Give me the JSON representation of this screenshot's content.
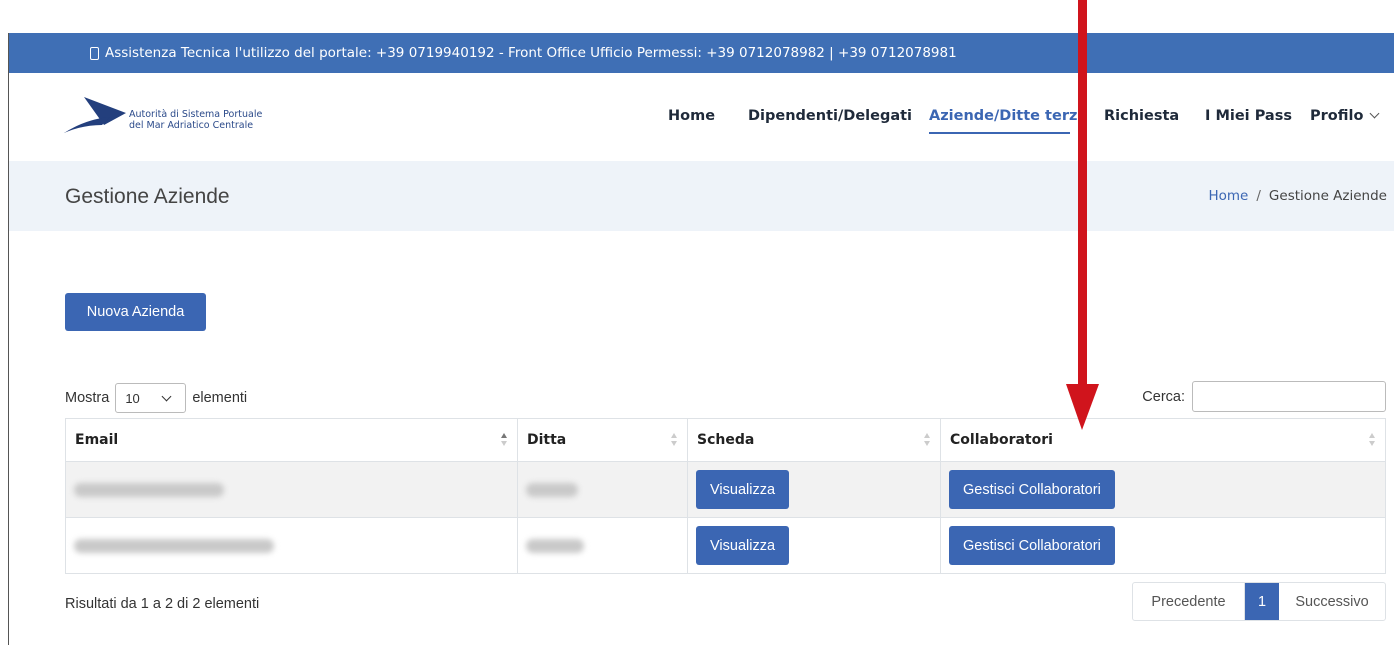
{
  "topbar": {
    "text": "Assistenza Tecnica l'utilizzo del portale: +39 0719940192 - Front Office Ufficio Permessi: +39 0712078982 | +39 0712078981"
  },
  "logo": {
    "line1": "Autorità di Sistema Portuale",
    "line2": "del Mar Adriatico Centrale"
  },
  "nav": {
    "items": [
      {
        "label": "Home"
      },
      {
        "label": "Dipendenti/Delegati"
      },
      {
        "label": "Aziende/Ditte terze",
        "active": true
      },
      {
        "label": "Richiesta"
      },
      {
        "label": "I Miei Pass"
      },
      {
        "label": "Profilo"
      }
    ]
  },
  "page": {
    "title": "Gestione Aziende",
    "breadcrumb_home": "Home",
    "breadcrumb_sep": "/",
    "breadcrumb_current": "Gestione Aziende"
  },
  "actions": {
    "new_company": "Nuova Azienda"
  },
  "table_controls": {
    "show_label": "Mostra",
    "page_size": "10",
    "elements_label": "elementi",
    "search_label": "Cerca:",
    "search_value": ""
  },
  "table": {
    "columns": [
      "Email",
      "Ditta",
      "Scheda",
      "Collaboratori"
    ],
    "rows": [
      {
        "view_label": "Visualizza",
        "manage_label": "Gestisci Collaboratori"
      },
      {
        "view_label": "Visualizza",
        "manage_label": "Gestisci Collaboratori"
      }
    ]
  },
  "footer": {
    "info": "Risultati da 1 a 2 di 2 elementi",
    "prev": "Precedente",
    "current_page": "1",
    "next": "Successivo"
  },
  "colors": {
    "primary": "#3b66b3",
    "topbar": "#3f6fb5",
    "annotation_arrow": "#d0141c"
  }
}
